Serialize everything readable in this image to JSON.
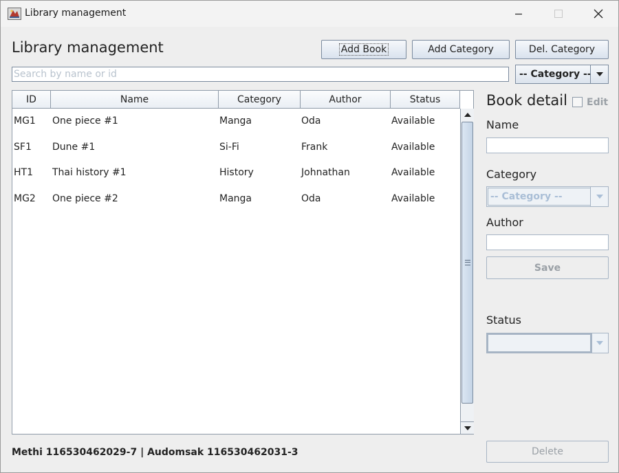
{
  "window": {
    "title": "Library management"
  },
  "header": {
    "heading": "Library management",
    "add_book_label": "Add Book",
    "add_category_label": "Add Category",
    "del_category_label": "Del. Category"
  },
  "search": {
    "placeholder": "Search by name or id",
    "value": ""
  },
  "category_filter": {
    "selected": "-- Category --"
  },
  "table": {
    "columns": [
      "ID",
      "Name",
      "Category",
      "Author",
      "Status"
    ],
    "rows": [
      {
        "id": "MG1",
        "name": "One piece #1",
        "category": "Manga",
        "author": "Oda",
        "status": "Available"
      },
      {
        "id": "SF1",
        "name": "Dune #1",
        "category": "Si-Fi",
        "author": "Frank",
        "status": "Available"
      },
      {
        "id": "HT1",
        "name": "Thai history #1",
        "category": "History",
        "author": "Johnathan",
        "status": "Available"
      },
      {
        "id": "MG2",
        "name": "One piece #2",
        "category": "Manga",
        "author": "Oda",
        "status": "Available"
      }
    ]
  },
  "detail": {
    "title": "Book detail",
    "edit_label": "Edit",
    "edit_checked": false,
    "name_label": "Name",
    "name_value": "",
    "category_label": "Category",
    "category_selected": "-- Category --",
    "author_label": "Author",
    "author_value": "",
    "save_label": "Save",
    "status_label": "Status",
    "status_selected": "",
    "delete_label": "Delete"
  },
  "footer": {
    "credits": "Methi 116530462029-7 | Audomsak 116530462031-3"
  },
  "colors": {
    "window_bg": "#eeeeee",
    "button_border": "#7a8a9e",
    "disabled_text": "#9aa0a6",
    "disabled_combo_text": "#a9bed6"
  }
}
